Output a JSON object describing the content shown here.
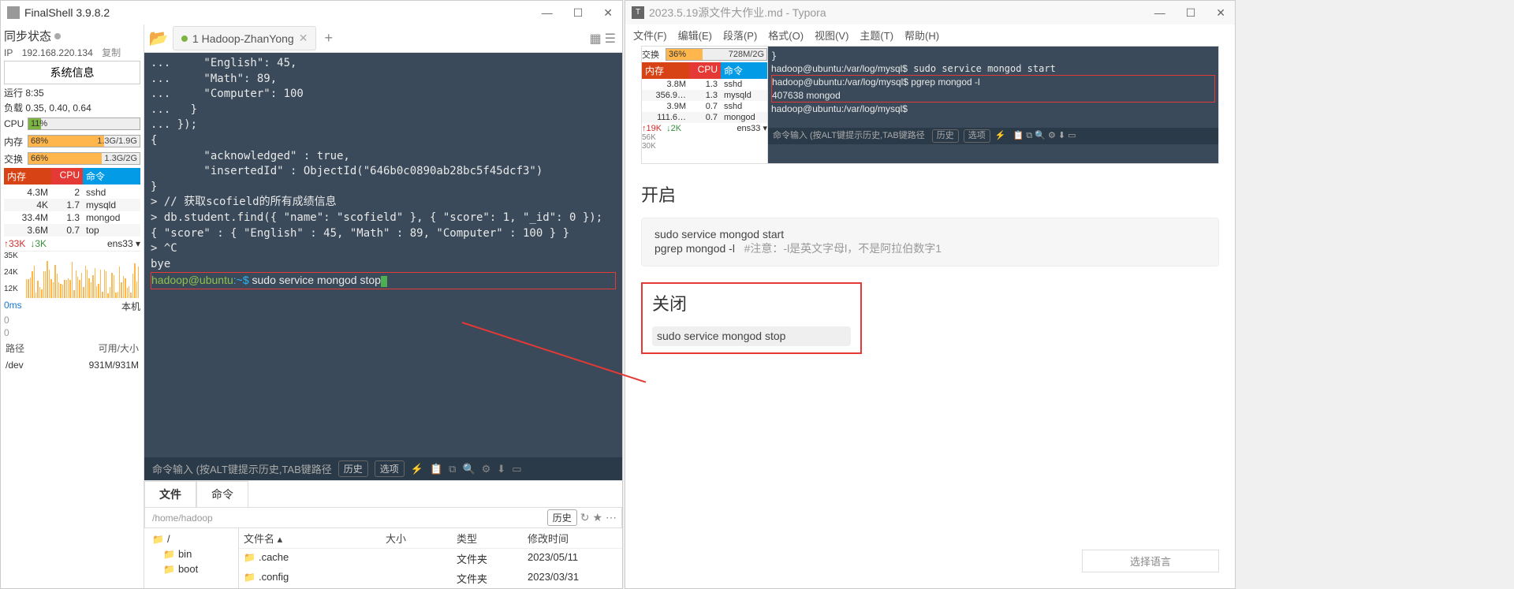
{
  "finalshell": {
    "title": "FinalShell 3.9.8.2",
    "sync_label": "同步状态",
    "ip_label": "IP",
    "ip_value": "192.168.220.134",
    "copy": "复制",
    "sys_info_btn": "系统信息",
    "uptime": "运行 8:35",
    "load": "负载 0.35, 0.40, 0.64",
    "cpu_label": "CPU",
    "cpu_pct": "11%",
    "mem_label": "内存",
    "mem_pct": "68%",
    "mem_val": "1.3G/1.9G",
    "swap_label": "交换",
    "swap_pct": "66%",
    "swap_val": "1.3G/2G",
    "proc_head": {
      "c1": "内存",
      "c2": "CPU",
      "c3": "命令"
    },
    "procs": [
      {
        "mem": "4.3M",
        "cpu": "2",
        "cmd": "sshd"
      },
      {
        "mem": "4K",
        "cpu": "1.7",
        "cmd": "mysqld"
      },
      {
        "mem": "33.4M",
        "cpu": "1.3",
        "cmd": "mongod"
      },
      {
        "mem": "3.6M",
        "cpu": "0.7",
        "cmd": "top"
      }
    ],
    "net_up": "↑33K",
    "net_dn": "↓3K",
    "net_if": "ens33 ▾",
    "chart_y": [
      "35K",
      "24K",
      "12K"
    ],
    "ms": "0ms",
    "host": "本机",
    "zero1": "0",
    "zero2": "0",
    "disk_h": {
      "a": "路径",
      "b": "可用/大小"
    },
    "disk": {
      "a": "/dev",
      "b": "931M/931M"
    },
    "tab_name": "1 Hadoop-ZhanYong",
    "term_lines": [
      "...     \"English\": 45,",
      "...     \"Math\": 89,",
      "...     \"Computer\": 100",
      "...   }",
      "... });",
      "{",
      "        \"acknowledged\" : true,",
      "        \"insertedId\" : ObjectId(\"646b0c0890ab28bc5f45dcf3\")",
      "}",
      "> // 获取scofield的所有成绩信息",
      "> db.student.find({ \"name\": \"scofield\" }, { \"score\": 1, \"_id\": 0 });",
      "{ \"score\" : { \"English\" : 45, \"Math\" : 89, \"Computer\" : 100 } }",
      "> ^C",
      "bye"
    ],
    "prompt_user": "hadoop@ubuntu",
    "prompt_path": ":~$",
    "prompt_cmd": " sudo service mongod stop",
    "cmd_hint": "命令输入 (按ALT键提示历史,TAB键路径",
    "cmd_hist": "历史",
    "cmd_opt": "选项",
    "ftab_file": "文件",
    "ftab_cmd": "命令",
    "path_val": "/home/hadoop",
    "path_hist": "历史",
    "tree_root": "/",
    "tree": [
      "bin",
      "boot"
    ],
    "fh": {
      "c1": "文件名 ▴",
      "c2": "大小",
      "c3": "类型",
      "c4": "修改时间"
    },
    "frows": [
      {
        "c1": ".cache",
        "c2": "",
        "c3": "文件夹",
        "c4": "2023/05/11"
      },
      {
        "c1": ".config",
        "c2": "",
        "c3": "文件夹",
        "c4": "2023/03/31"
      }
    ]
  },
  "typora": {
    "title": "2023.5.19源文件大作业.md - Typora",
    "menu": [
      "文件(F)",
      "编辑(E)",
      "段落(P)",
      "格式(O)",
      "视图(V)",
      "主题(T)",
      "帮助(H)"
    ],
    "sshot": {
      "swap": "交换",
      "swap_pct": "36%",
      "swap_val": "728M/2G",
      "ph": {
        "c1": "内存",
        "c2": "CPU",
        "c3": "命令"
      },
      "procs": [
        {
          "mem": "3.8M",
          "cpu": "1.3",
          "cmd": "sshd"
        },
        {
          "mem": "356.9…",
          "cpu": "1.3",
          "cmd": "mysqld"
        },
        {
          "mem": "3.9M",
          "cpu": "0.7",
          "cmd": "sshd"
        },
        {
          "mem": "111.6…",
          "cpu": "0.7",
          "cmd": "mongod"
        }
      ],
      "net_up": "↑19K",
      "net_dn": "↓2K",
      "net_if": "ens33 ▾",
      "chart_y": [
        "56K",
        "30K"
      ],
      "t1": "}",
      "t2": "hadoop@ubuntu:/var/log/mysql$ sudo service mongod start",
      "t3": "hadoop@ubuntu:/var/log/mysql$ pgrep mongod -l",
      "t4": "407638 mongod",
      "t5": "hadoop@ubuntu:/var/log/mysql$ ",
      "cmd_hint": "命令输入 (按ALT键提示历史,TAB键路径",
      "hist": "历史",
      "opt": "选项"
    },
    "h_open": "开启",
    "code1": "sudo service mongod start",
    "code2": "pgrep mongod -l",
    "note": "#注意：-l是英文字母l，不是阿拉伯数字1",
    "h_close": "关闭",
    "code3": "sudo service mongod stop",
    "langsel": "选择语言"
  }
}
